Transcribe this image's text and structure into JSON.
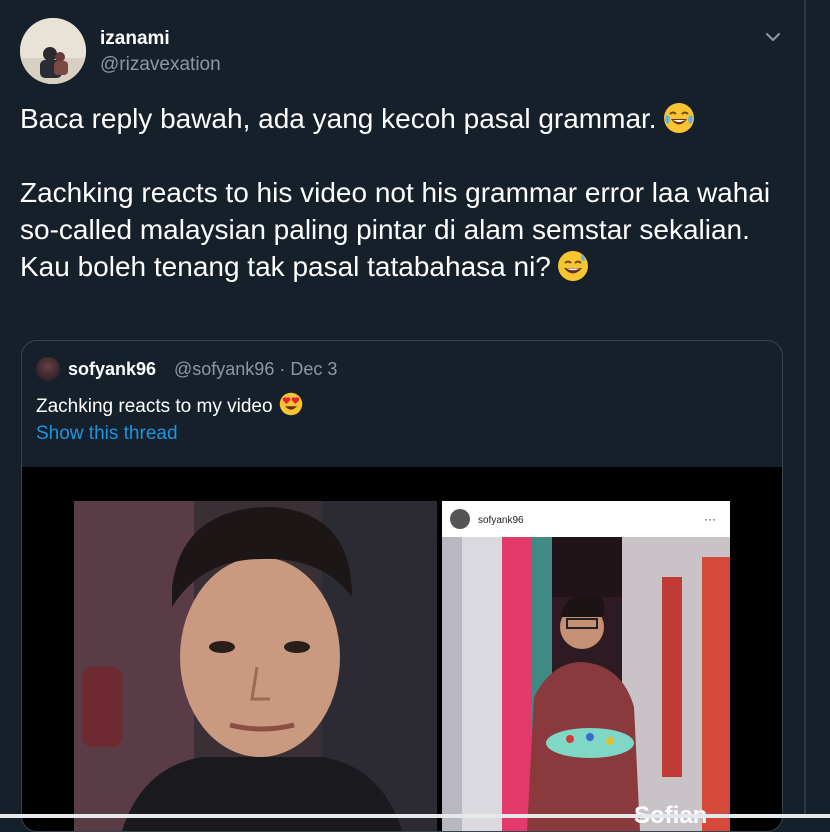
{
  "tweet": {
    "display_name": "izanami",
    "handle": "@rizavexation",
    "text_line1": "Baca reply bawah, ada yang kecoh pasal grammar.",
    "text_para2": "Zachking reacts to his video not his grammar error laa wahai so-called malaysian paling pintar di alam semstar sekalian. Kau boleh tenang tak pasal tatabahasa ni?",
    "emoji1": "face-with-tears-of-joy",
    "emoji2": "grinning-face-with-sweat"
  },
  "quoted_tweet": {
    "display_name": "sofyank96",
    "meta": "@sofyank96 · Dec 3",
    "text": "Zachking reacts to my video",
    "emoji": "smiling-face-with-heart-eyes",
    "show_thread_label": "Show this thread",
    "inner_post_username": "sofyank96",
    "inner_post_menu": "···",
    "video_caption": "Sofian"
  },
  "colors": {
    "background": "#15202b",
    "secondary_text": "#8899a6",
    "link": "#1b95e0",
    "border": "#38444d"
  }
}
